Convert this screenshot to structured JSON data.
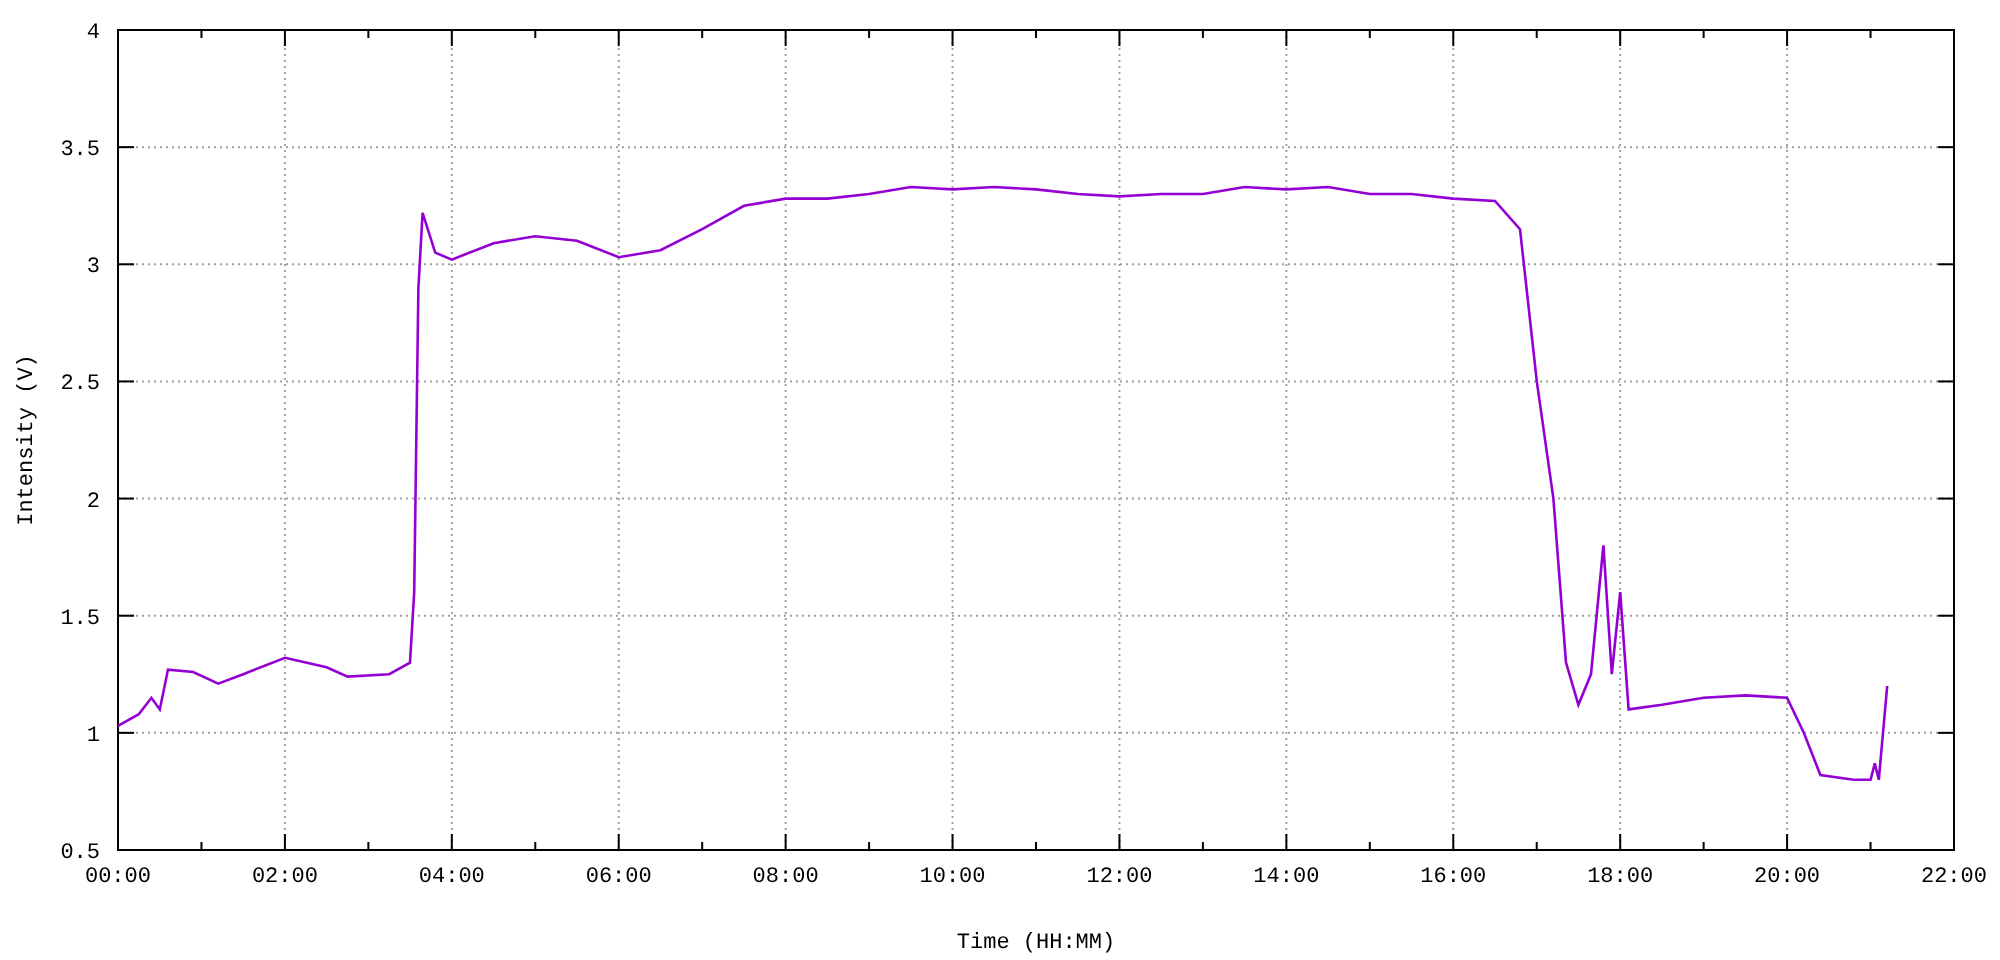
{
  "chart_data": {
    "type": "line",
    "xlabel": "Time (HH:MM)",
    "ylabel": "Intensity (V)",
    "grid": true,
    "xlim": [
      0,
      22
    ],
    "ylim": [
      0.5,
      4
    ],
    "xticks": [
      {
        "value": 0,
        "label": "00:00"
      },
      {
        "value": 2,
        "label": "02:00"
      },
      {
        "value": 4,
        "label": "04:00"
      },
      {
        "value": 6,
        "label": "06:00"
      },
      {
        "value": 8,
        "label": "08:00"
      },
      {
        "value": 10,
        "label": "10:00"
      },
      {
        "value": 12,
        "label": "12:00"
      },
      {
        "value": 14,
        "label": "14:00"
      },
      {
        "value": 16,
        "label": "16:00"
      },
      {
        "value": 18,
        "label": "18:00"
      },
      {
        "value": 20,
        "label": "20:00"
      },
      {
        "value": 22,
        "label": "22:00"
      }
    ],
    "yticks": [
      0.5,
      1,
      1.5,
      2,
      2.5,
      3,
      3.5,
      4
    ],
    "x": [
      0,
      0.25,
      0.4,
      0.5,
      0.6,
      0.9,
      1.2,
      1.5,
      2,
      2.5,
      2.75,
      3.25,
      3.5,
      3.55,
      3.6,
      3.65,
      3.8,
      4,
      4.5,
      5,
      5.5,
      6,
      6.5,
      7,
      7.5,
      8,
      8.5,
      9,
      9.5,
      10,
      10.5,
      11,
      11.5,
      12,
      12.5,
      13,
      13.5,
      14,
      14.5,
      15,
      15.5,
      16,
      16.5,
      16.8,
      17,
      17.2,
      17.35,
      17.5,
      17.65,
      17.8,
      17.9,
      18,
      18.1,
      18.5,
      19,
      19.5,
      20,
      20.2,
      20.4,
      20.8,
      21,
      21.05,
      21.1,
      21.2
    ],
    "series": [
      {
        "color": "#9400d3",
        "values": [
          1.03,
          1.08,
          1.15,
          1.1,
          1.27,
          1.26,
          1.21,
          1.25,
          1.32,
          1.28,
          1.24,
          1.25,
          1.3,
          1.6,
          2.9,
          3.22,
          3.05,
          3.02,
          3.09,
          3.12,
          3.1,
          3.03,
          3.06,
          3.15,
          3.25,
          3.28,
          3.28,
          3.3,
          3.33,
          3.32,
          3.33,
          3.32,
          3.3,
          3.29,
          3.3,
          3.3,
          3.33,
          3.32,
          3.33,
          3.3,
          3.3,
          3.28,
          3.27,
          3.15,
          2.5,
          2.0,
          1.3,
          1.12,
          1.25,
          1.8,
          1.25,
          1.6,
          1.1,
          1.12,
          1.15,
          1.16,
          1.15,
          1.0,
          0.82,
          0.8,
          0.8,
          0.87,
          0.8,
          1.2
        ]
      }
    ]
  }
}
